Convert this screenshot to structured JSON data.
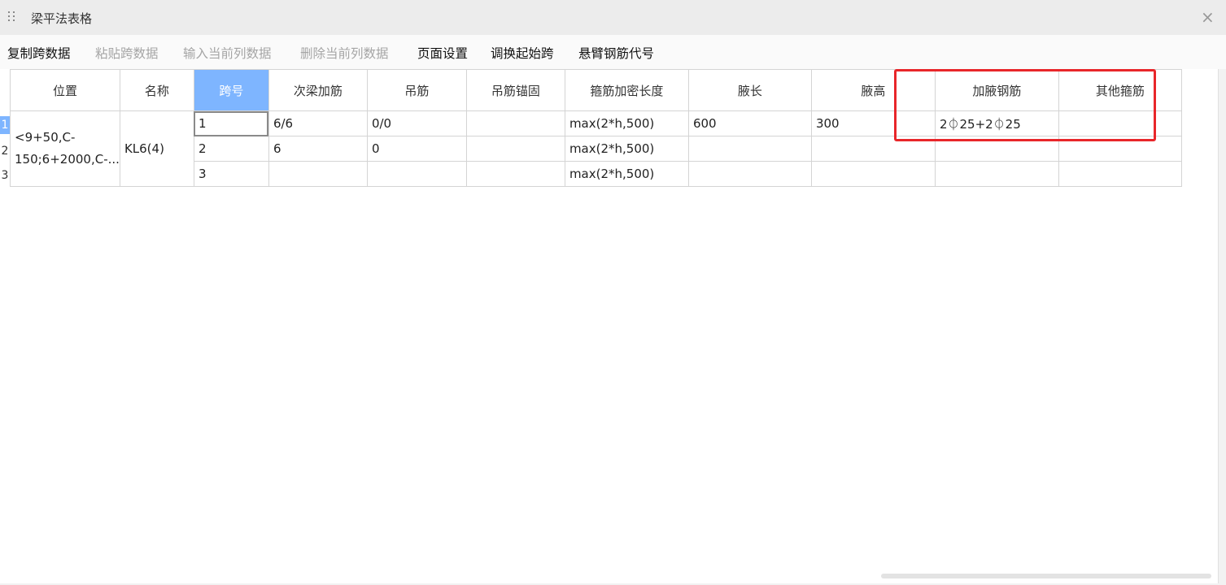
{
  "window": {
    "title": "梁平法表格",
    "close_icon": "×"
  },
  "toolbar": {
    "items": [
      {
        "label": "复制跨数据",
        "enabled": true
      },
      {
        "label": "粘贴跨数据",
        "enabled": false
      },
      {
        "label": "输入当前列数据",
        "enabled": false
      },
      {
        "label": "删除当前列数据",
        "enabled": false
      },
      {
        "label": "页面设置",
        "enabled": true
      },
      {
        "label": "调换起始跨",
        "enabled": true
      },
      {
        "label": "悬臂钢筋代号",
        "enabled": true
      }
    ]
  },
  "table": {
    "row_numbers": [
      "1",
      "2",
      "3"
    ],
    "columns": [
      "位置",
      "名称",
      "跨号",
      "次梁加筋",
      "吊筋",
      "吊筋锚固",
      "箍筋加密长度",
      "腋长",
      "腋高",
      "加腋钢筋",
      "其他箍筋"
    ],
    "active_column": "跨号",
    "merged": {
      "position": "<9+50,C-150;6+2000,C-...",
      "name": "KL6(4)"
    },
    "rows": [
      {
        "span": "1",
        "secondary_beam_rebar": "6/6",
        "hanger": "0/0",
        "hanger_anchor": "",
        "stirrup_dense_length": "max(2*h,500)",
        "haunch_length": "600",
        "haunch_height": "300",
        "haunch_rebar": "2⏀25+2⏀25",
        "other_stirrup": ""
      },
      {
        "span": "2",
        "secondary_beam_rebar": "6",
        "hanger": "0",
        "hanger_anchor": "",
        "stirrup_dense_length": "max(2*h,500)",
        "haunch_length": "",
        "haunch_height": "",
        "haunch_rebar": "",
        "other_stirrup": ""
      },
      {
        "span": "3",
        "secondary_beam_rebar": "",
        "hanger": "",
        "hanger_anchor": "",
        "stirrup_dense_length": "max(2*h,500)",
        "haunch_length": "",
        "haunch_height": "",
        "haunch_rebar": "",
        "other_stirrup": ""
      }
    ]
  },
  "colors": {
    "highlight_box": "#e8262a",
    "active_header": "#7eb5ff"
  }
}
